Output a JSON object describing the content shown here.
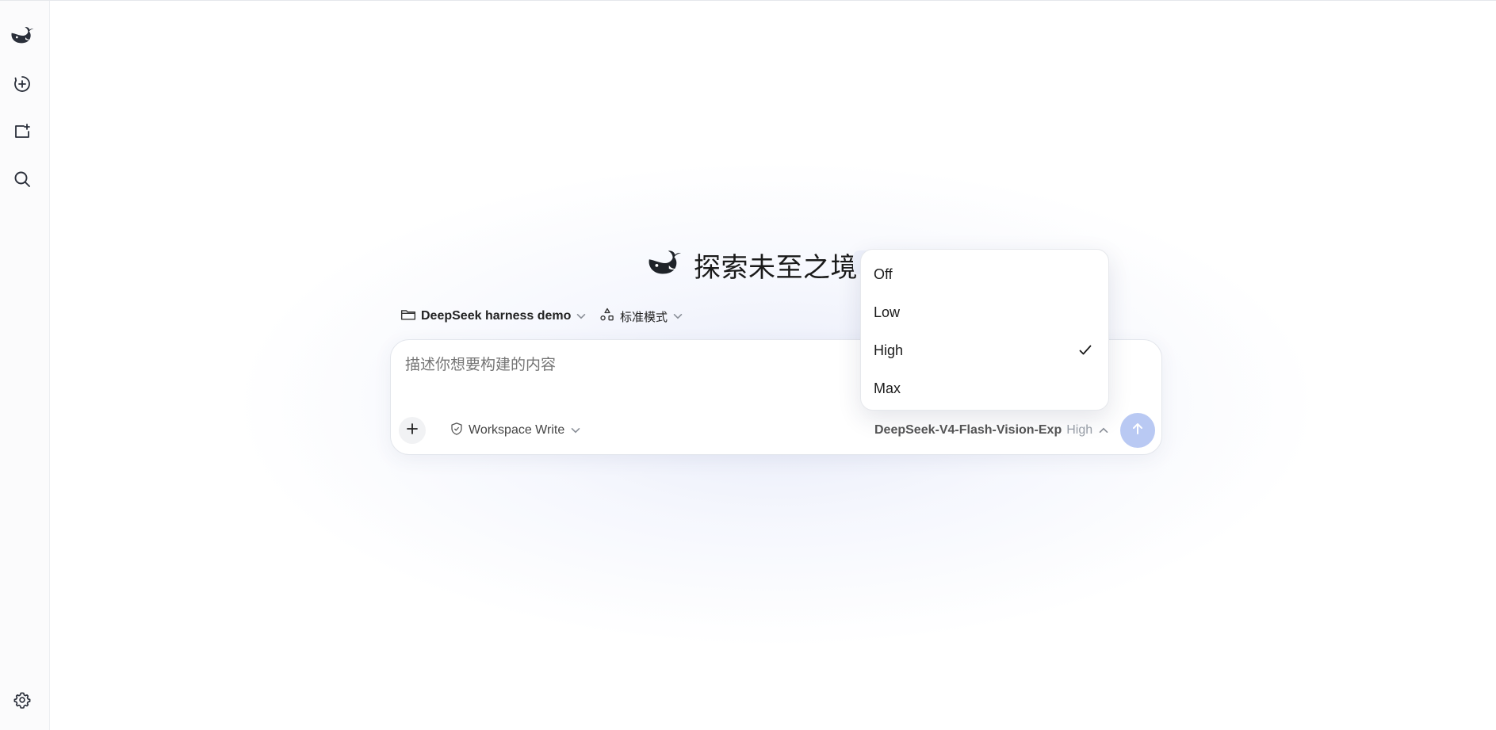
{
  "hero": {
    "title": "探索未至之境"
  },
  "chips": {
    "project_label": "DeepSeek harness demo",
    "mode_label": "标准模式"
  },
  "composer": {
    "placeholder": "描述你想要构建的内容",
    "permission_label": "Workspace Write",
    "model_name": "DeepSeek-V4-Flash-Vision-Exp",
    "reasoning_level": "High"
  },
  "reasoning_menu": {
    "options": [
      {
        "label": "Off",
        "selected": false
      },
      {
        "label": "Low",
        "selected": false
      },
      {
        "label": "High",
        "selected": true
      },
      {
        "label": "Max",
        "selected": false
      }
    ]
  },
  "icons": {
    "sidebar": [
      "whale-logo-icon",
      "new-chat-icon",
      "new-project-icon",
      "search-icon",
      "settings-icon"
    ],
    "composer": [
      "plus-icon",
      "shield-icon",
      "chevron-down-icon",
      "chevron-up-icon",
      "arrow-up-icon"
    ]
  },
  "colors": {
    "send_button": "#b9c9f3",
    "background_glow": "#e4e8f8",
    "text_primary": "#1a1a1a",
    "text_muted": "#9aa0a8"
  }
}
